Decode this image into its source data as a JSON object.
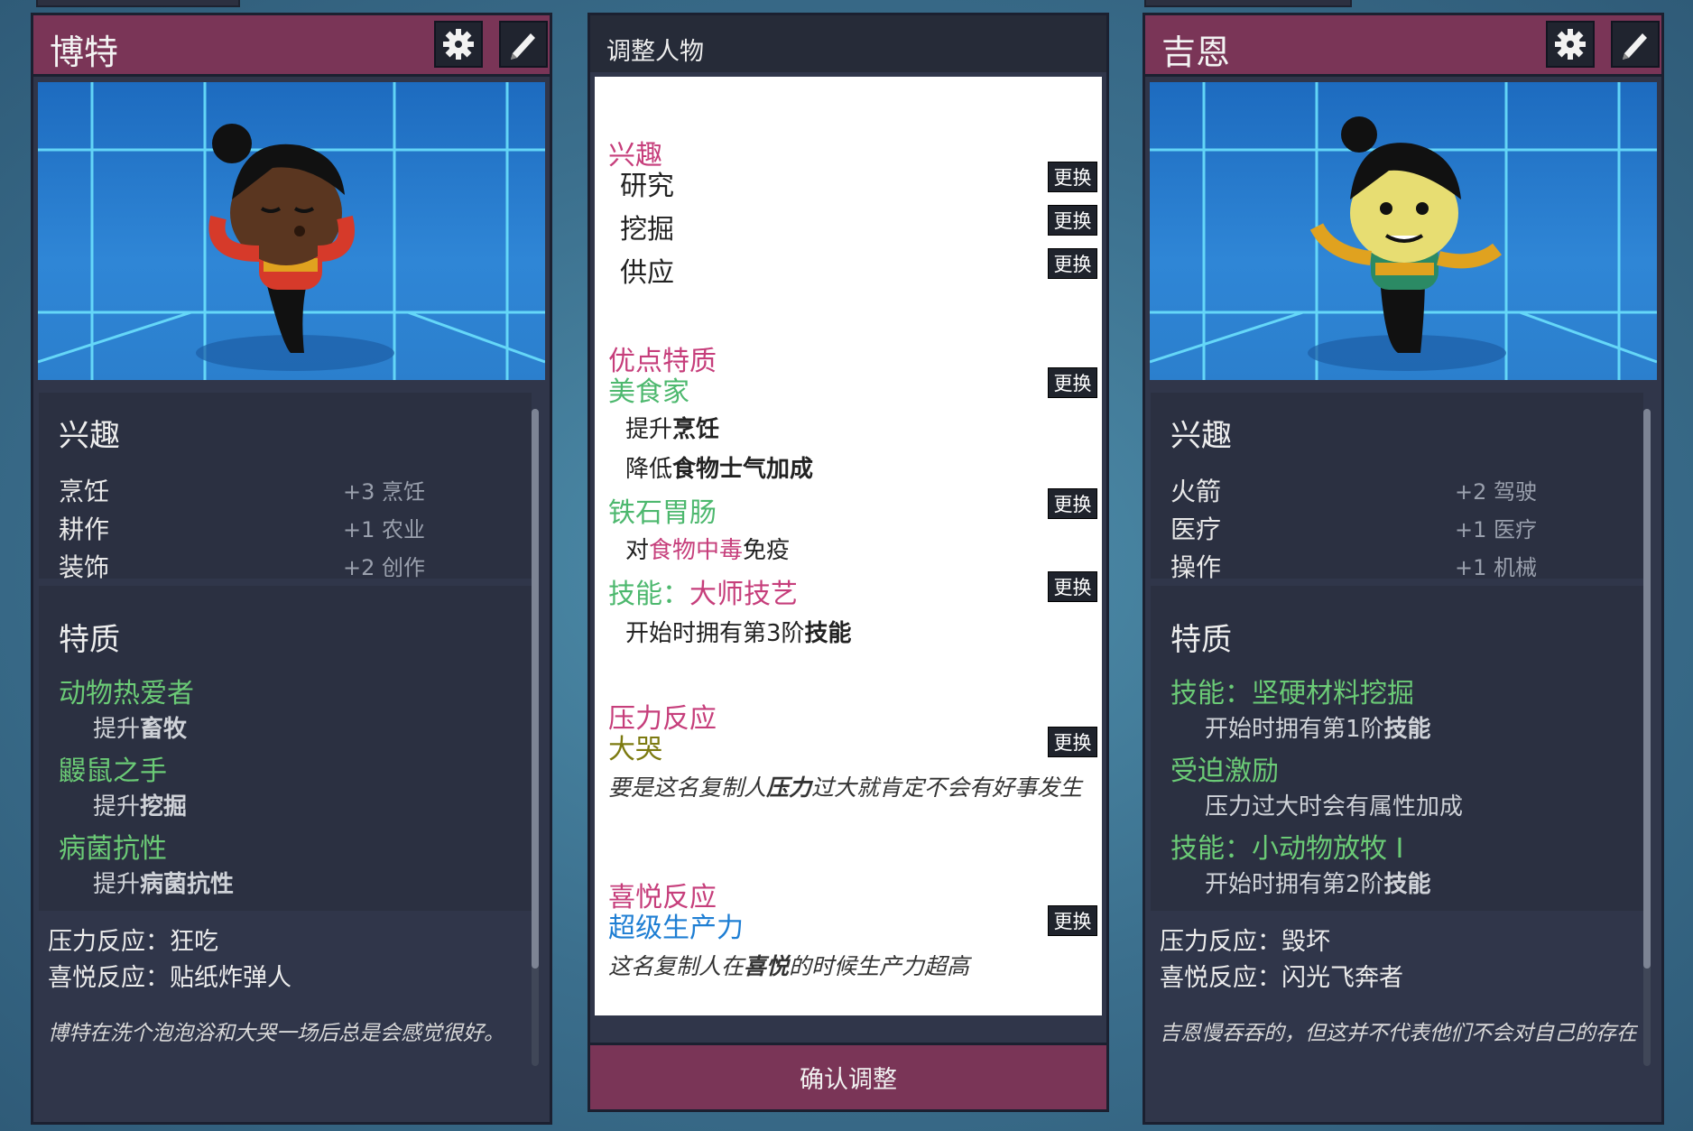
{
  "left": {
    "name": "博特",
    "interests_title": "兴趣",
    "interests": [
      {
        "name": "烹饪",
        "bonus": "+3 烹饪"
      },
      {
        "name": "耕作",
        "bonus": "+1 农业"
      },
      {
        "name": "装饰",
        "bonus": "+2 创作"
      }
    ],
    "traits_title": "特质",
    "traits": [
      {
        "name": "动物热爱者",
        "desc_pre": "提升",
        "desc_bold": "畜牧"
      },
      {
        "name": "鼹鼠之手",
        "desc_pre": "提升",
        "desc_bold": "挖掘"
      },
      {
        "name": "病菌抗性",
        "desc_pre": "提升",
        "desc_bold": "病菌抗性"
      }
    ],
    "stress_line": "压力反应：狂吃",
    "joy_line": "喜悦反应：贴纸炸弹人",
    "bio": "博特在洗个泡泡浴和大哭一场后总是会感觉很好。"
  },
  "right": {
    "name": "吉恩",
    "interests_title": "兴趣",
    "interests": [
      {
        "name": "火箭",
        "bonus": "+2 驾驶"
      },
      {
        "name": "医疗",
        "bonus": "+1 医疗"
      },
      {
        "name": "操作",
        "bonus": "+1 机械"
      }
    ],
    "traits_title": "特质",
    "traits": [
      {
        "name": "技能：坚硬材料挖掘",
        "desc_pre": "开始时拥有第1阶",
        "desc_bold": "技能"
      },
      {
        "name": "受迫激励",
        "desc_pre": "压力过大时会有属性加成",
        "desc_bold": ""
      },
      {
        "name": "技能：小动物放牧 I",
        "desc_pre": "开始时拥有第2阶",
        "desc_bold": "技能"
      }
    ],
    "stress_line": "压力反应：毁坏",
    "joy_line": "喜悦反应：闪光飞奔者",
    "bio": "吉恩慢吞吞的，但这并不代表他们不会对自己的存在有一丝不满。"
  },
  "center": {
    "title": "调整人物",
    "swap_label": "更换",
    "interests_title": "兴趣",
    "interests": [
      "研究",
      "挖掘",
      "供应"
    ],
    "good_traits_title": "优点特质",
    "trait1": {
      "name": "美食家",
      "desc1_pre": "提升",
      "desc1_bold": "烹饪",
      "desc2_pre": "降低",
      "desc2_bold": "食物士气加成"
    },
    "trait2": {
      "name": "铁石胃肠",
      "desc_pre": "对",
      "desc_hl": "食物中毒",
      "desc_post": "免疫"
    },
    "trait3": {
      "name_pre": "技能：",
      "name_main": "大师技艺",
      "desc_pre": "开始时拥有第3阶",
      "desc_bold": "技能"
    },
    "stress_title": "压力反应",
    "stress_name": "大哭",
    "stress_desc_pre": "要是这名复制人",
    "stress_desc_bold": "压力",
    "stress_desc_post": "过大就肯定不会有好事发生",
    "joy_title": "喜悦反应",
    "joy_name": "超级生产力",
    "joy_desc_pre": "这名复制人在",
    "joy_desc_bold": "喜悦",
    "joy_desc_post": "的时候生产力超高",
    "confirm_label": "确认调整"
  }
}
